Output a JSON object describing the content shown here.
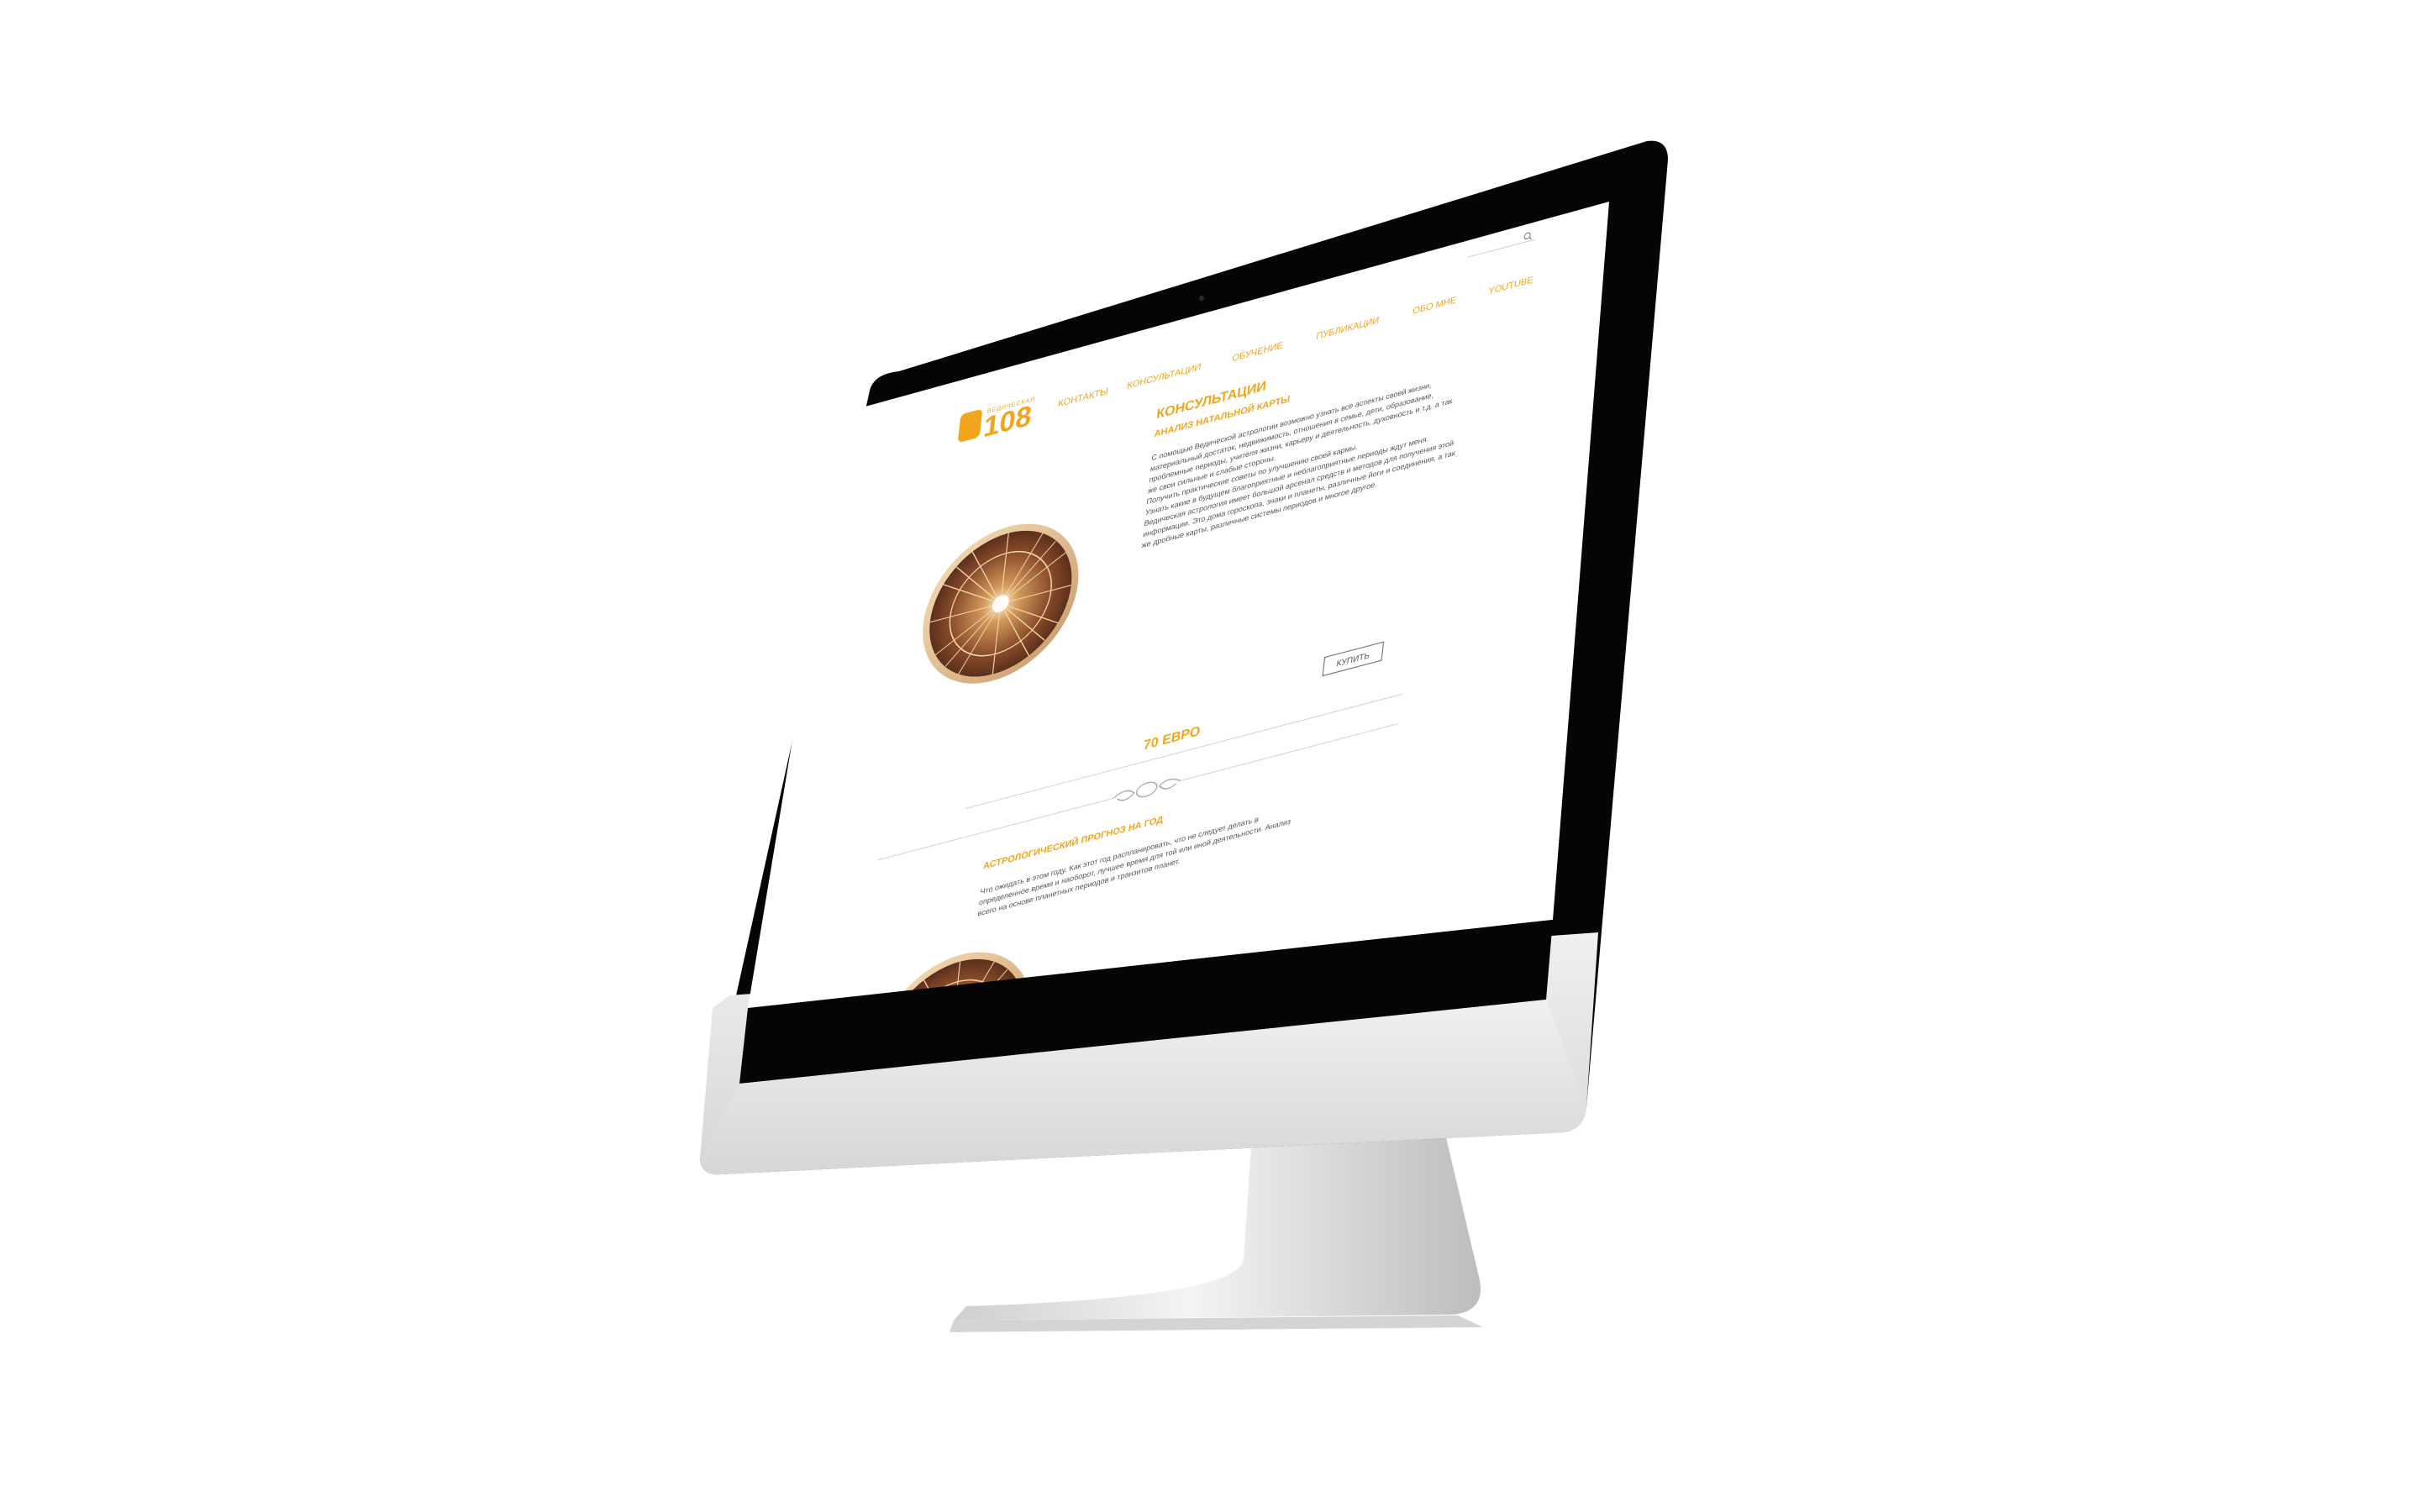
{
  "logo": {
    "caption": "ВЕДИЧЕСКАЯ",
    "number": "108"
  },
  "nav": {
    "items": [
      "КОНТАКТЫ",
      "КОНСУЛЬТАЦИИ",
      "ОБУЧЕНИЕ",
      "ПУБЛИКАЦИИ",
      "ОБО МНЕ",
      "YOUTUBE"
    ]
  },
  "search": {
    "placeholder": ""
  },
  "page": {
    "title": "КОНСУЛЬТАЦИИ"
  },
  "products": [
    {
      "title": "АНАЛИЗ НАТАЛЬНОЙ КАРТЫ",
      "description": [
        "С помощью Ведической астрологии возможно узнать все аспекты своей жизни,",
        "материальный достаток, недвижимость, отношения в семье, дети, образование,",
        "проблемные периоды, учителя жизни, карьеру и деятельность, духовность и т.д. а так",
        "же свои сильные и слабые стороны.",
        "Получить практические советы по улучшению своей кармы.",
        "Узнать какие в будущем благоприятные и неблагоприятные периоды ждут меня.",
        "Ведическая астрология имеет большой арсенал средств и методов для получения этой",
        "информации. Это дома гороскопа, знаки и планеты, различные йоги и соединения, а так",
        "же дробные карты, различные системы периодов и многое другое."
      ],
      "buy_label": "КУПИТЬ",
      "price": "70 ЕВРО"
    },
    {
      "title": "АСТРОЛОГИЧЕСКИЙ ПРОГНОЗ НА ГОД",
      "description": [
        "Что ожидать в этом году. Как этот год распланировать, что не следует делать в",
        "определенное время и наоборот, лучшее время для той или иной деятельности. Анализ",
        "всего на основе планетных периодов и транзитов планет."
      ]
    }
  ],
  "colors": {
    "accent": "#f2a51a",
    "text": "#555555",
    "bezel": "#000000",
    "chin": "#e6e6e6",
    "wheel_dark": "#6e3a22",
    "wheel_light": "#f3d2a3"
  }
}
